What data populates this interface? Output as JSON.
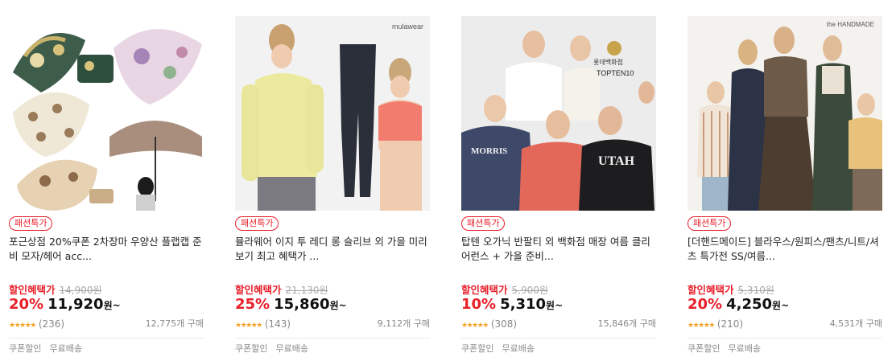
{
  "products": [
    {
      "badge": "패션특가",
      "title": "포근상점 20%쿠폰 2차장마 우양산 플랩캡 준비 모자/헤어 acc...",
      "benefit_label": "할인혜택가",
      "original_price": "14,900원",
      "discount_rate": "20%",
      "price": "11,920",
      "currency": "원",
      "tilde": "~",
      "stars": "★★★★★",
      "rating_count": "(236)",
      "sold": "12,775개 구매",
      "tags": [
        "쿠폰할인",
        "무료배송"
      ],
      "image": "umbrellas"
    },
    {
      "badge": "패션특가",
      "title": "뮬라웨어 이지 투 레디 롱 슬리브 외 가을 미리보기 최고 혜택가 ...",
      "benefit_label": "할인혜택가",
      "original_price": "21,130원",
      "discount_rate": "25%",
      "price": "15,860",
      "currency": "원",
      "tilde": "~",
      "stars": "★★★★★",
      "rating_count": "(143)",
      "sold": "9,112개 구매",
      "tags": [
        "쿠폰할인",
        "무료배송"
      ],
      "image": "activewear",
      "brand_mark": "mulawear"
    },
    {
      "badge": "패션특가",
      "title": "탑텐 오가닉 반팔티 외 백화점 매장 여름 클리어런스 + 가을 준비...",
      "benefit_label": "할인혜택가",
      "original_price": "5,900원",
      "discount_rate": "10%",
      "price": "5,310",
      "currency": "원",
      "tilde": "~",
      "stars": "★★★★★",
      "rating_count": "(308)",
      "sold": "15,846개 구매",
      "tags": [
        "쿠폰할인",
        "무료배송"
      ],
      "image": "tshirts",
      "brand_mark": "롯데백화점",
      "brand_mark_2": "TOPTEN10",
      "shirt_text_1": "MORRIS",
      "shirt_text_2": "UTAH"
    },
    {
      "badge": "패션특가",
      "title": "[더핸드메이드] 블라우스/원피스/팬츠/니트/셔츠 특가전 SS/여름...",
      "benefit_label": "할인혜택가",
      "original_price": "5,310원",
      "discount_rate": "20%",
      "price": "4,250",
      "currency": "원",
      "tilde": "~",
      "stars": "★★★★★",
      "rating_count": "(210)",
      "sold": "4,531개 구매",
      "tags": [
        "쿠폰할인",
        "무료배송"
      ],
      "image": "womenswear",
      "brand_mark": "the HANDMADE"
    }
  ],
  "colors": {
    "accent_red": "#e8202a",
    "star_orange": "#f4a32a",
    "muted_gray": "#888888"
  }
}
